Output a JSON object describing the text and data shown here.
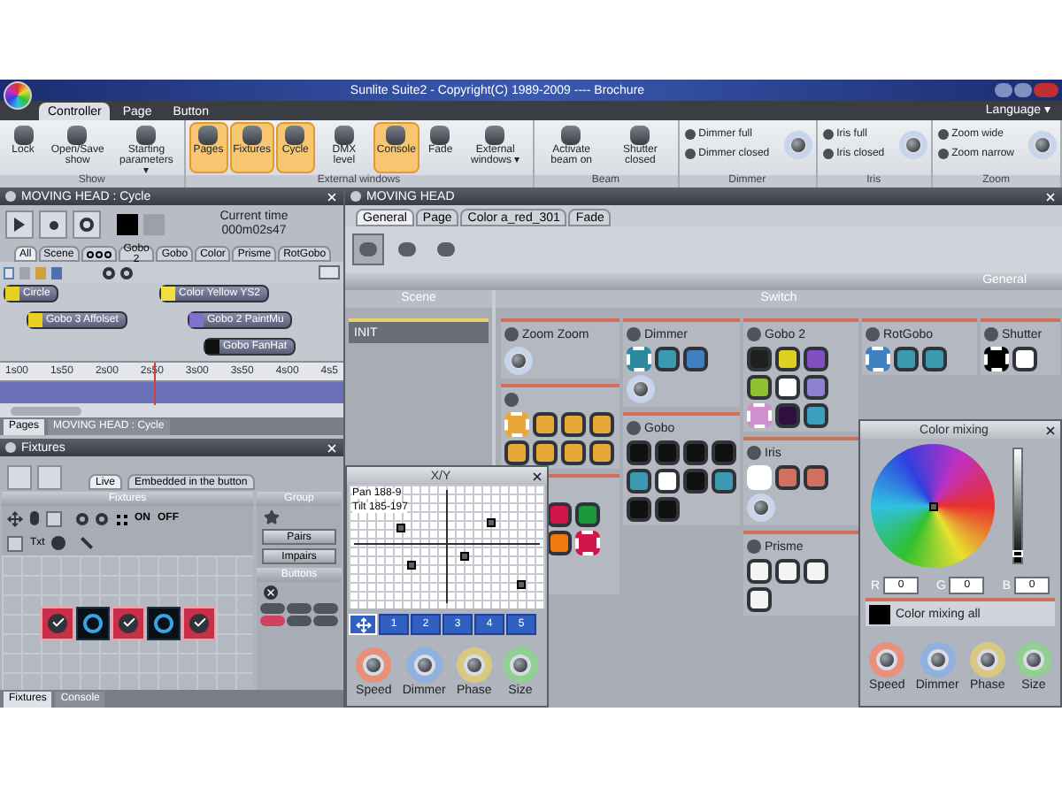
{
  "window": {
    "title": "Sunlite Suite2 - Copyright(C) 1989-2009 ---- Brochure"
  },
  "ribbon": {
    "tabs": [
      {
        "label": "Controller",
        "selected": true
      },
      {
        "label": "Page",
        "selected": false
      },
      {
        "label": "Button",
        "selected": false
      }
    ],
    "language": "Language ▾",
    "groups": [
      {
        "label": "Show",
        "knob": false,
        "items": [
          {
            "kind": "large",
            "label": "Lock",
            "active": false
          },
          {
            "kind": "large",
            "label": "Open/Save show",
            "active": false
          },
          {
            "kind": "large",
            "label": "Starting parameters ▾",
            "active": false
          }
        ]
      },
      {
        "label": "External windows",
        "knob": false,
        "items": [
          {
            "kind": "large",
            "label": "Pages",
            "active": true
          },
          {
            "kind": "large",
            "label": "Fixtures",
            "active": true
          },
          {
            "kind": "large",
            "label": "Cycle",
            "active": true
          },
          {
            "kind": "large",
            "label": "DMX level",
            "active": false
          },
          {
            "kind": "large",
            "label": "Console",
            "active": true
          },
          {
            "kind": "large",
            "label": "Fade",
            "active": false
          },
          {
            "kind": "large",
            "label": "External windows ▾",
            "active": false
          }
        ]
      },
      {
        "label": "Beam",
        "knob": false,
        "items": [
          {
            "kind": "large",
            "label": "Activate beam on",
            "active": false
          },
          {
            "kind": "large",
            "label": "Shutter closed",
            "active": false
          }
        ]
      },
      {
        "label": "Dimmer",
        "knob": true,
        "items": [
          {
            "kind": "small",
            "label": "Dimmer full",
            "active": false
          },
          {
            "kind": "small",
            "label": "Dimmer closed",
            "active": false
          }
        ]
      },
      {
        "label": "Iris",
        "knob": true,
        "items": [
          {
            "kind": "small",
            "label": "Iris full",
            "active": false
          },
          {
            "kind": "small",
            "label": "Iris closed",
            "active": false
          }
        ]
      },
      {
        "label": "Zoom",
        "knob": true,
        "items": [
          {
            "kind": "small",
            "label": "Zoom wide",
            "active": false
          },
          {
            "kind": "small",
            "label": "Zoom narrow",
            "active": false
          }
        ]
      }
    ]
  },
  "cycle": {
    "title": "MOVING HEAD : Cycle",
    "time_label": "Current time",
    "time": "000m02s47",
    "tabs": [
      {
        "kind": "text",
        "label": "All",
        "selected": true
      },
      {
        "kind": "text",
        "label": "Scene",
        "selected": false
      },
      {
        "kind": "icon",
        "selected": false
      },
      {
        "kind": "text",
        "label": "Gobo 2",
        "selected": false
      },
      {
        "kind": "text",
        "label": "Gobo",
        "selected": false
      },
      {
        "kind": "text",
        "label": "Color",
        "selected": false
      },
      {
        "kind": "text",
        "label": "Prisme",
        "selected": false
      },
      {
        "kind": "text",
        "label": "RotGobo",
        "selected": false
      }
    ],
    "tracks": [
      [
        {
          "label": "Circle",
          "color": "#e8d020"
        },
        {
          "label": "Color Yellow YS2",
          "color": "#f0e040"
        }
      ],
      [
        {
          "label": "Gobo 3 Affolset",
          "color": "#e8d020"
        },
        {
          "label": "Gobo 2 PaintMu",
          "color": "#8070d0"
        }
      ],
      [
        {
          "label": "Gobo FanHat",
          "color": "#101010"
        }
      ]
    ],
    "ruler": [
      "1s00",
      "1s50",
      "2s00",
      "2s50",
      "3s00",
      "3s50",
      "4s00",
      "4s5"
    ],
    "playhead": {
      "level": 0.45
    },
    "bottom_tabs": [
      {
        "label": "Pages",
        "selected": true
      },
      {
        "label": "MOVING HEAD : Cycle",
        "selected": false
      }
    ]
  },
  "fixtures": {
    "title": "Fixtures",
    "tabs": [
      {
        "label": "Live",
        "selected": true
      },
      {
        "label": "Embedded in the button",
        "selected": false
      }
    ],
    "section": "Fixtures",
    "on": "ON",
    "off": "OFF",
    "txt": "Txt",
    "items": [
      {
        "selected": true
      },
      {
        "selected": false
      },
      {
        "selected": true
      },
      {
        "selected": false
      },
      {
        "selected": true
      }
    ],
    "group": {
      "title": "Group",
      "items": [
        "Pairs",
        "Impairs"
      ]
    },
    "buttons_title": "Buttons",
    "buttons": [
      {
        "on": false
      },
      {
        "on": false
      },
      {
        "on": false
      },
      {
        "on": true
      },
      {
        "on": false
      },
      {
        "on": false
      }
    ],
    "bottom_tabs": [
      {
        "label": "Fixtures",
        "selected": true
      },
      {
        "label": "Console",
        "selected": false
      }
    ]
  },
  "moving_head": {
    "title": "MOVING HEAD",
    "tabs": [
      {
        "label": "General",
        "selected": true
      },
      {
        "label": "Page",
        "selected": false
      },
      {
        "label": "Color a_red_301",
        "selected": false
      },
      {
        "label": "Fade",
        "selected": false
      }
    ],
    "toolbar": [
      {
        "selected": true
      },
      {
        "selected": false
      },
      {
        "selected": false
      }
    ],
    "section": "General",
    "scene": {
      "title": "Scene",
      "items": [
        "INIT"
      ]
    },
    "switch": {
      "title": "Switch",
      "columns": [
        [
          {
            "title": "Zoom Zoom",
            "knob": true
          },
          {
            "knob": false,
            "tiles": [
              {
                "color": "#e8a838",
                "selected": true
              },
              {
                "color": "#e8a838",
                "selected": false
              },
              {
                "color": "#e8a838",
                "selected": false
              },
              {
                "color": "#e8a838",
                "selected": false
              },
              {
                "color": "#e8a838",
                "selected": false
              },
              {
                "color": "#e8a838",
                "selected": false
              },
              {
                "color": "#e8a838",
                "selected": false
              },
              {
                "color": "#e8a838",
                "selected": false
              }
            ]
          },
          {
            "knob": false,
            "tiles": [
              {
                "color": "#d0164a",
                "selected": false
              },
              {
                "color": "#1a9a3a",
                "selected": false
              },
              {
                "color": "#f07a10",
                "selected": false
              },
              {
                "color": "#d0164a",
                "selected": true
              }
            ]
          }
        ],
        [
          {
            "title": "Dimmer",
            "knob": true,
            "tiles": [
              {
                "color": "#2a8aa0",
                "selected": true
              },
              {
                "color": "#3a9ab0",
                "selected": false
              },
              {
                "color": "#4080c0",
                "selected": false
              }
            ]
          },
          {
            "title": "Gobo",
            "knob": false,
            "tiles": [
              {
                "color": "#101010",
                "selected": false
              },
              {
                "color": "#101010",
                "selected": false
              },
              {
                "color": "#101010",
                "selected": false
              },
              {
                "color": "#101010",
                "selected": false
              },
              {
                "color": "#3a9ab0",
                "selected": false
              },
              {
                "color": "#ffffff",
                "selected": false
              },
              {
                "color": "#101010",
                "selected": false
              },
              {
                "color": "#3a9ab0",
                "selected": false
              },
              {
                "color": "#101010",
                "selected": false
              },
              {
                "color": "#101010",
                "selected": false
              }
            ]
          }
        ],
        [
          {
            "title": "Gobo 2",
            "knob": false,
            "tiles": [
              {
                "color": "#202020",
                "selected": false
              },
              {
                "color": "#e0d020",
                "selected": false
              },
              {
                "color": "#8050c0",
                "selected": false
              },
              {
                "color": "#90c030",
                "selected": false
              },
              {
                "color": "#ffffff",
                "selected": false
              },
              {
                "color": "#9080d0",
                "selected": false
              },
              {
                "color": "#d090d0",
                "selected": true
              },
              {
                "color": "#301040",
                "selected": false
              },
              {
                "color": "#3aa0c0",
                "selected": false
              }
            ]
          },
          {
            "title": "Iris",
            "knob": true,
            "tiles": [
              {
                "color": "#ffffff",
                "selected": true
              },
              {
                "color": "#d07060",
                "selected": false
              },
              {
                "color": "#d07060",
                "selected": false
              }
            ]
          },
          {
            "title": "Prisme",
            "knob": false,
            "tiles": [
              {
                "color": "#f4f4f4",
                "selected": false
              },
              {
                "color": "#f4f4f4",
                "selected": false
              },
              {
                "color": "#f4f4f4",
                "selected": false
              },
              {
                "color": "#f4f4f4",
                "selected": false
              }
            ]
          }
        ],
        [
          {
            "title": "RotGobo",
            "knob": false,
            "tiles": [
              {
                "color": "#4080c0",
                "selected": true
              },
              {
                "color": "#3a9ab0",
                "selected": false
              },
              {
                "color": "#3a9ab0",
                "selected": false
              }
            ]
          }
        ],
        [
          {
            "title": "Shutter",
            "knob": false,
            "tiles": [
              {
                "color": "#000000",
                "selected": true
              },
              {
                "color": "#ffffff",
                "selected": false
              }
            ]
          }
        ]
      ]
    }
  },
  "xy": {
    "title": "X/Y",
    "pan": "Pan 188-9",
    "tilt": "Tilt 185-197",
    "presets": [
      {
        "kind": "all",
        "selected": true
      },
      {
        "kind": "numbered",
        "label": "1",
        "selected": false
      },
      {
        "kind": "numbered",
        "label": "2",
        "selected": false
      },
      {
        "kind": "numbered",
        "label": "3",
        "selected": false
      },
      {
        "kind": "numbered",
        "label": "4",
        "selected": false
      },
      {
        "kind": "numbered",
        "label": "5",
        "selected": false
      }
    ],
    "knobs": [
      {
        "label": "Speed",
        "color": "#e8907a"
      },
      {
        "label": "Dimmer",
        "color": "#90b0e0"
      },
      {
        "label": "Phase",
        "color": "#d8c880"
      },
      {
        "label": "Size",
        "color": "#90d090"
      }
    ]
  },
  "color_mixing": {
    "title": "Color mixing",
    "brightness": {
      "level": 0.05
    },
    "channels": [
      {
        "label": "R",
        "value": "0"
      },
      {
        "label": "G",
        "value": "0"
      },
      {
        "label": "B",
        "value": "0"
      }
    ],
    "all_label": "Color mixing all",
    "knobs": [
      {
        "label": "Speed",
        "color": "#e8907a"
      },
      {
        "label": "Dimmer",
        "color": "#90b0e0"
      },
      {
        "label": "Phase",
        "color": "#d8c880"
      },
      {
        "label": "Size",
        "color": "#90d090"
      }
    ]
  }
}
